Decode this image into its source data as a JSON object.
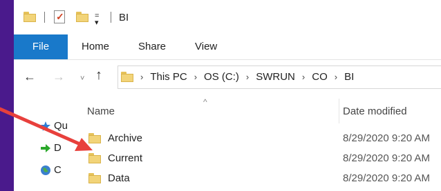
{
  "window": {
    "title": "BI",
    "quick_access": {
      "dropdown_glyph": "=",
      "dropdown_arrow": "▾"
    }
  },
  "ribbon": {
    "file_label": "File",
    "tabs": [
      {
        "label": "Home"
      },
      {
        "label": "Share"
      },
      {
        "label": "View"
      }
    ]
  },
  "navigation": {
    "back_glyph": "←",
    "forward_glyph": "→",
    "recent_glyph": "˅",
    "up_glyph": "↑"
  },
  "address_bar": {
    "separator": "›",
    "path": [
      "This PC",
      "OS (C:)",
      "SWRUN",
      "CO",
      "BI"
    ]
  },
  "nav_pane": {
    "items": [
      {
        "label": "Qu",
        "icon": "star-icon"
      },
      {
        "label": "D",
        "icon": "download-arrow-icon"
      },
      {
        "label": "C",
        "icon": "globe-icon"
      }
    ]
  },
  "file_list": {
    "columns": {
      "name": "Name",
      "date_modified": "Date modified",
      "sort_glyph": "^"
    },
    "rows": [
      {
        "name": "Archive",
        "date": "8/29/2020 9:20 AM",
        "icon": "folder-icon"
      },
      {
        "name": "Current",
        "date": "8/29/2020 9:20 AM",
        "icon": "folder-icon"
      },
      {
        "name": "Data",
        "date": "8/29/2020 9:20 AM",
        "icon": "folder-icon"
      }
    ]
  },
  "annotation": {
    "arrow_color": "#e8403c",
    "points_to": "Current"
  },
  "colors": {
    "background": "#4a1a8c",
    "file_tab": "#1979ca",
    "folder": "#f2d479"
  }
}
